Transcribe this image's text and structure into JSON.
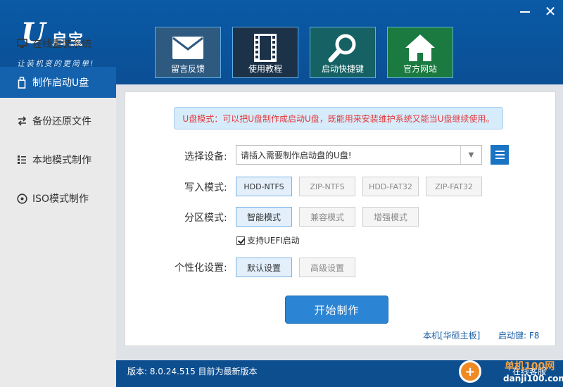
{
  "app": {
    "logo_letter": "U",
    "logo_name": "启宝",
    "slogan": "让装机变的更简单!"
  },
  "window": {
    "minimize_glyph": "",
    "close_glyph": "✕"
  },
  "toolbar": {
    "feedback_label": "留言反馈",
    "tutorial_label": "使用教程",
    "hotkey_label": "启动快捷键",
    "website_label": "官方网站"
  },
  "sidebar": {
    "items": [
      {
        "label": "在线重装系统",
        "icon": "monitor-icon"
      },
      {
        "label": "制作启动U盘",
        "icon": "usb-icon"
      },
      {
        "label": "备份还原文件",
        "icon": "backup-icon"
      },
      {
        "label": "本地模式制作",
        "icon": "list-icon"
      },
      {
        "label": "ISO模式制作",
        "icon": "disc-icon"
      }
    ]
  },
  "main": {
    "notice": "U盘模式：可以把U盘制作成启动U盘，既能用来安装维护系统又能当U盘继续使用。",
    "device_label": "选择设备:",
    "device_value": "请插入需要制作启动盘的U盘!",
    "write_mode_label": "写入模式:",
    "write_modes": [
      "HDD-NTFS",
      "ZIP-NTFS",
      "HDD-FAT32",
      "ZIP-FAT32"
    ],
    "partition_label": "分区模式:",
    "partition_modes": [
      "智能模式",
      "兼容模式",
      "增强模式"
    ],
    "uefi_label": "支持UEFI启动",
    "custom_label": "个性化设置:",
    "custom_options": [
      "默认设置",
      "高级设置"
    ],
    "start_button": "开始制作",
    "board_info": "本机[华硕主板]",
    "hotkey_info": "启动键: F8"
  },
  "footer": {
    "version": "版本: 8.0.24.515 目前为最新版本",
    "online_service": "在线客服"
  },
  "watermark": {
    "title": "单机100网",
    "site": "danji100.com"
  },
  "colors": {
    "header": "#0b4f95",
    "active_nav": "#1462ad",
    "start_button": "#2c84d4",
    "notice_text": "#e0383a"
  }
}
